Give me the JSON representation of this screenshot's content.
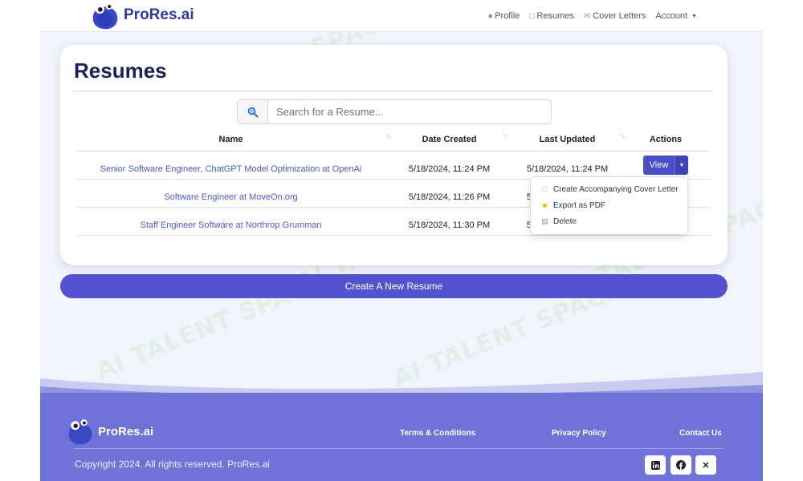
{
  "navbar": {
    "brand": "ProRes.ai",
    "links": [
      {
        "label": "Profile",
        "icon": "flame-icon"
      },
      {
        "label": "Resumes",
        "icon": "document-icon"
      },
      {
        "label": "Cover Letters",
        "icon": "envelope-icon"
      },
      {
        "label": "Account",
        "icon": "chevron-down-icon"
      }
    ]
  },
  "watermark": "AI TALENT SPACE",
  "main": {
    "title": "Resumes",
    "search": {
      "placeholder": "Search for a Resume..."
    },
    "table": {
      "headers": [
        "Name",
        "Date Created",
        "Last Updated",
        "Actions"
      ],
      "rows": [
        {
          "name": "Senior Software Engineer, ChatGPT Model Optimization at OpenAi",
          "created": "5/18/2024, 11:24 PM",
          "updated": "5/18/2024, 11:24 PM"
        },
        {
          "name": "Software Engineer at MoveOn.org",
          "created": "5/18/2024, 11:26 PM",
          "updated": "5/18/2024, 11:26 PM"
        },
        {
          "name": "Staff Engineer Software at Northrop Grumman",
          "created": "5/18/2024, 11:30 PM",
          "updated": "5/18/2024, 11:30 PM"
        }
      ],
      "view_label": "View"
    },
    "dropdown": [
      {
        "label": "Create Accompanying Cover Letter",
        "icon": "document-icon"
      },
      {
        "label": "Export as PDF",
        "icon": "folder-icon"
      },
      {
        "label": "Delete",
        "icon": "trash-icon"
      }
    ],
    "create_label": "Create A New Resume"
  },
  "footer": {
    "brand": "ProRes.ai",
    "links": [
      "Terms & Conditions",
      "Privacy Policy",
      "Contact Us"
    ],
    "copyright": "Copyright 2024. All rights reserved. ProRes.ai",
    "social": [
      "linkedin-icon",
      "facebook-icon",
      "x-icon"
    ]
  },
  "colors": {
    "primary": "#5353cf",
    "footer": "#6f73d8",
    "title": "#1c2055",
    "link": "#4a5bc4"
  }
}
